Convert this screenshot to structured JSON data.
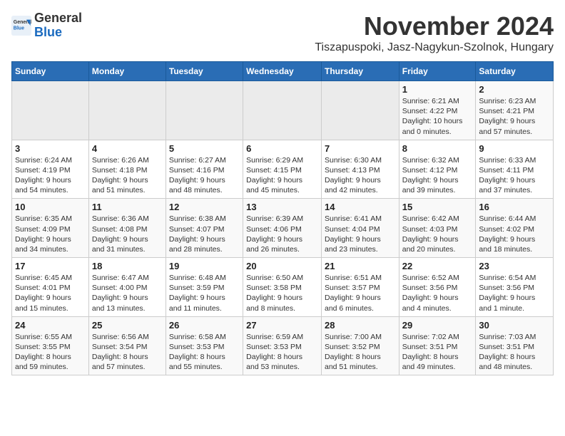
{
  "logo": {
    "line1": "General",
    "line2": "Blue"
  },
  "title": "November 2024",
  "subtitle": "Tiszapuspoki, Jasz-Nagykun-Szolnok, Hungary",
  "days_of_week": [
    "Sunday",
    "Monday",
    "Tuesday",
    "Wednesday",
    "Thursday",
    "Friday",
    "Saturday"
  ],
  "weeks": [
    [
      {
        "day": "",
        "info": ""
      },
      {
        "day": "",
        "info": ""
      },
      {
        "day": "",
        "info": ""
      },
      {
        "day": "",
        "info": ""
      },
      {
        "day": "",
        "info": ""
      },
      {
        "day": "1",
        "info": "Sunrise: 6:21 AM\nSunset: 4:22 PM\nDaylight: 10 hours\nand 0 minutes."
      },
      {
        "day": "2",
        "info": "Sunrise: 6:23 AM\nSunset: 4:21 PM\nDaylight: 9 hours\nand 57 minutes."
      }
    ],
    [
      {
        "day": "3",
        "info": "Sunrise: 6:24 AM\nSunset: 4:19 PM\nDaylight: 9 hours\nand 54 minutes."
      },
      {
        "day": "4",
        "info": "Sunrise: 6:26 AM\nSunset: 4:18 PM\nDaylight: 9 hours\nand 51 minutes."
      },
      {
        "day": "5",
        "info": "Sunrise: 6:27 AM\nSunset: 4:16 PM\nDaylight: 9 hours\nand 48 minutes."
      },
      {
        "day": "6",
        "info": "Sunrise: 6:29 AM\nSunset: 4:15 PM\nDaylight: 9 hours\nand 45 minutes."
      },
      {
        "day": "7",
        "info": "Sunrise: 6:30 AM\nSunset: 4:13 PM\nDaylight: 9 hours\nand 42 minutes."
      },
      {
        "day": "8",
        "info": "Sunrise: 6:32 AM\nSunset: 4:12 PM\nDaylight: 9 hours\nand 39 minutes."
      },
      {
        "day": "9",
        "info": "Sunrise: 6:33 AM\nSunset: 4:11 PM\nDaylight: 9 hours\nand 37 minutes."
      }
    ],
    [
      {
        "day": "10",
        "info": "Sunrise: 6:35 AM\nSunset: 4:09 PM\nDaylight: 9 hours\nand 34 minutes."
      },
      {
        "day": "11",
        "info": "Sunrise: 6:36 AM\nSunset: 4:08 PM\nDaylight: 9 hours\nand 31 minutes."
      },
      {
        "day": "12",
        "info": "Sunrise: 6:38 AM\nSunset: 4:07 PM\nDaylight: 9 hours\nand 28 minutes."
      },
      {
        "day": "13",
        "info": "Sunrise: 6:39 AM\nSunset: 4:06 PM\nDaylight: 9 hours\nand 26 minutes."
      },
      {
        "day": "14",
        "info": "Sunrise: 6:41 AM\nSunset: 4:04 PM\nDaylight: 9 hours\nand 23 minutes."
      },
      {
        "day": "15",
        "info": "Sunrise: 6:42 AM\nSunset: 4:03 PM\nDaylight: 9 hours\nand 20 minutes."
      },
      {
        "day": "16",
        "info": "Sunrise: 6:44 AM\nSunset: 4:02 PM\nDaylight: 9 hours\nand 18 minutes."
      }
    ],
    [
      {
        "day": "17",
        "info": "Sunrise: 6:45 AM\nSunset: 4:01 PM\nDaylight: 9 hours\nand 15 minutes."
      },
      {
        "day": "18",
        "info": "Sunrise: 6:47 AM\nSunset: 4:00 PM\nDaylight: 9 hours\nand 13 minutes."
      },
      {
        "day": "19",
        "info": "Sunrise: 6:48 AM\nSunset: 3:59 PM\nDaylight: 9 hours\nand 11 minutes."
      },
      {
        "day": "20",
        "info": "Sunrise: 6:50 AM\nSunset: 3:58 PM\nDaylight: 9 hours\nand 8 minutes."
      },
      {
        "day": "21",
        "info": "Sunrise: 6:51 AM\nSunset: 3:57 PM\nDaylight: 9 hours\nand 6 minutes."
      },
      {
        "day": "22",
        "info": "Sunrise: 6:52 AM\nSunset: 3:56 PM\nDaylight: 9 hours\nand 4 minutes."
      },
      {
        "day": "23",
        "info": "Sunrise: 6:54 AM\nSunset: 3:56 PM\nDaylight: 9 hours\nand 1 minute."
      }
    ],
    [
      {
        "day": "24",
        "info": "Sunrise: 6:55 AM\nSunset: 3:55 PM\nDaylight: 8 hours\nand 59 minutes."
      },
      {
        "day": "25",
        "info": "Sunrise: 6:56 AM\nSunset: 3:54 PM\nDaylight: 8 hours\nand 57 minutes."
      },
      {
        "day": "26",
        "info": "Sunrise: 6:58 AM\nSunset: 3:53 PM\nDaylight: 8 hours\nand 55 minutes."
      },
      {
        "day": "27",
        "info": "Sunrise: 6:59 AM\nSunset: 3:53 PM\nDaylight: 8 hours\nand 53 minutes."
      },
      {
        "day": "28",
        "info": "Sunrise: 7:00 AM\nSunset: 3:52 PM\nDaylight: 8 hours\nand 51 minutes."
      },
      {
        "day": "29",
        "info": "Sunrise: 7:02 AM\nSunset: 3:51 PM\nDaylight: 8 hours\nand 49 minutes."
      },
      {
        "day": "30",
        "info": "Sunrise: 7:03 AM\nSunset: 3:51 PM\nDaylight: 8 hours\nand 48 minutes."
      }
    ]
  ]
}
